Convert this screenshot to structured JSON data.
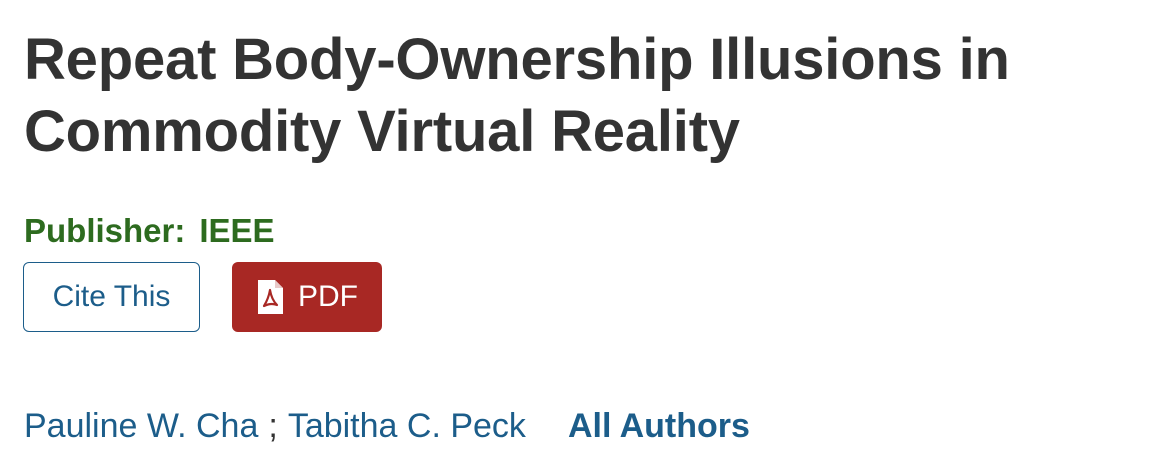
{
  "article": {
    "title": "Repeat Body-Ownership Illusions in Commodity Virtual Reality"
  },
  "publisher": {
    "label": "Publisher:",
    "name": "IEEE"
  },
  "actions": {
    "cite_label": "Cite This",
    "pdf_label": "PDF",
    "pdf_icon": "pdf-file-icon"
  },
  "authors": {
    "list": [
      {
        "name": "Pauline W. Cha"
      },
      {
        "name": "Tabitha C. Peck"
      }
    ],
    "separator": ";",
    "all_authors_label": "All Authors"
  },
  "colors": {
    "title": "#333333",
    "publisher": "#2d6b1f",
    "link": "#1c5d8a",
    "pdf_button": "#a82824"
  }
}
